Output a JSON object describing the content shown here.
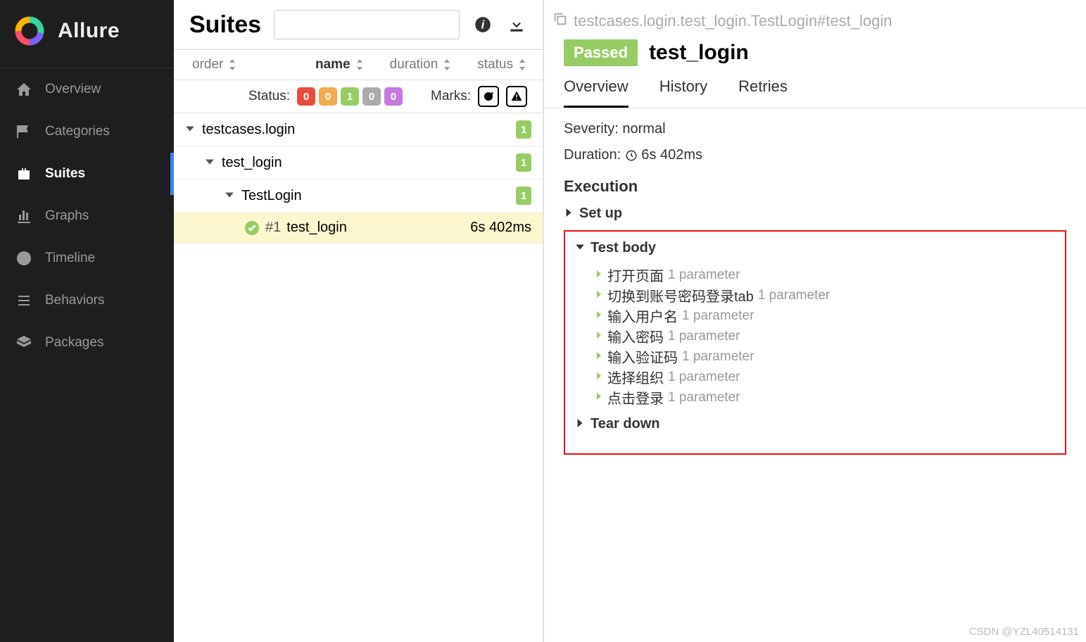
{
  "brand": "Allure",
  "sidebar": {
    "items": [
      {
        "label": "Overview",
        "icon": "home"
      },
      {
        "label": "Categories",
        "icon": "flag"
      },
      {
        "label": "Suites",
        "icon": "briefcase",
        "active": true
      },
      {
        "label": "Graphs",
        "icon": "bars"
      },
      {
        "label": "Timeline",
        "icon": "clock"
      },
      {
        "label": "Behaviors",
        "icon": "list"
      },
      {
        "label": "Packages",
        "icon": "layers"
      }
    ]
  },
  "mid": {
    "title": "Suites",
    "columns": {
      "order": "order",
      "name": "name",
      "duration": "duration",
      "status": "status"
    },
    "filters": {
      "status_label": "Status:",
      "status_counts": [
        "0",
        "0",
        "1",
        "0",
        "0"
      ],
      "marks_label": "Marks:"
    },
    "tree": [
      {
        "level": 0,
        "label": "testcases.login",
        "badge": "1"
      },
      {
        "level": 1,
        "label": "test_login",
        "badge": "1"
      },
      {
        "level": 2,
        "label": "TestLogin",
        "badge": "1"
      },
      {
        "level": 3,
        "num": "#1",
        "label": "test_login",
        "duration": "6s 402ms"
      }
    ]
  },
  "right": {
    "breadcrumb": "testcases.login.test_login.TestLogin#test_login",
    "status": "Passed",
    "title": "test_login",
    "tabs": [
      "Overview",
      "History",
      "Retries"
    ],
    "severity_label": "Severity:",
    "severity": "normal",
    "duration_label": "Duration:",
    "duration": "6s 402ms",
    "execution_label": "Execution",
    "setup_label": "Set up",
    "testbody_label": "Test body",
    "teardown_label": "Tear down",
    "steps": [
      {
        "name": "打开页面",
        "params": "1 parameter"
      },
      {
        "name": "切换到账号密码登录tab",
        "params": "1 parameter"
      },
      {
        "name": "输入用户名",
        "params": "1 parameter"
      },
      {
        "name": "输入密码",
        "params": "1 parameter"
      },
      {
        "name": "输入验证码",
        "params": "1 parameter"
      },
      {
        "name": "选择组织",
        "params": "1 parameter"
      },
      {
        "name": "点击登录",
        "params": "1 parameter"
      }
    ]
  },
  "watermark": "CSDN @YZL40514131"
}
